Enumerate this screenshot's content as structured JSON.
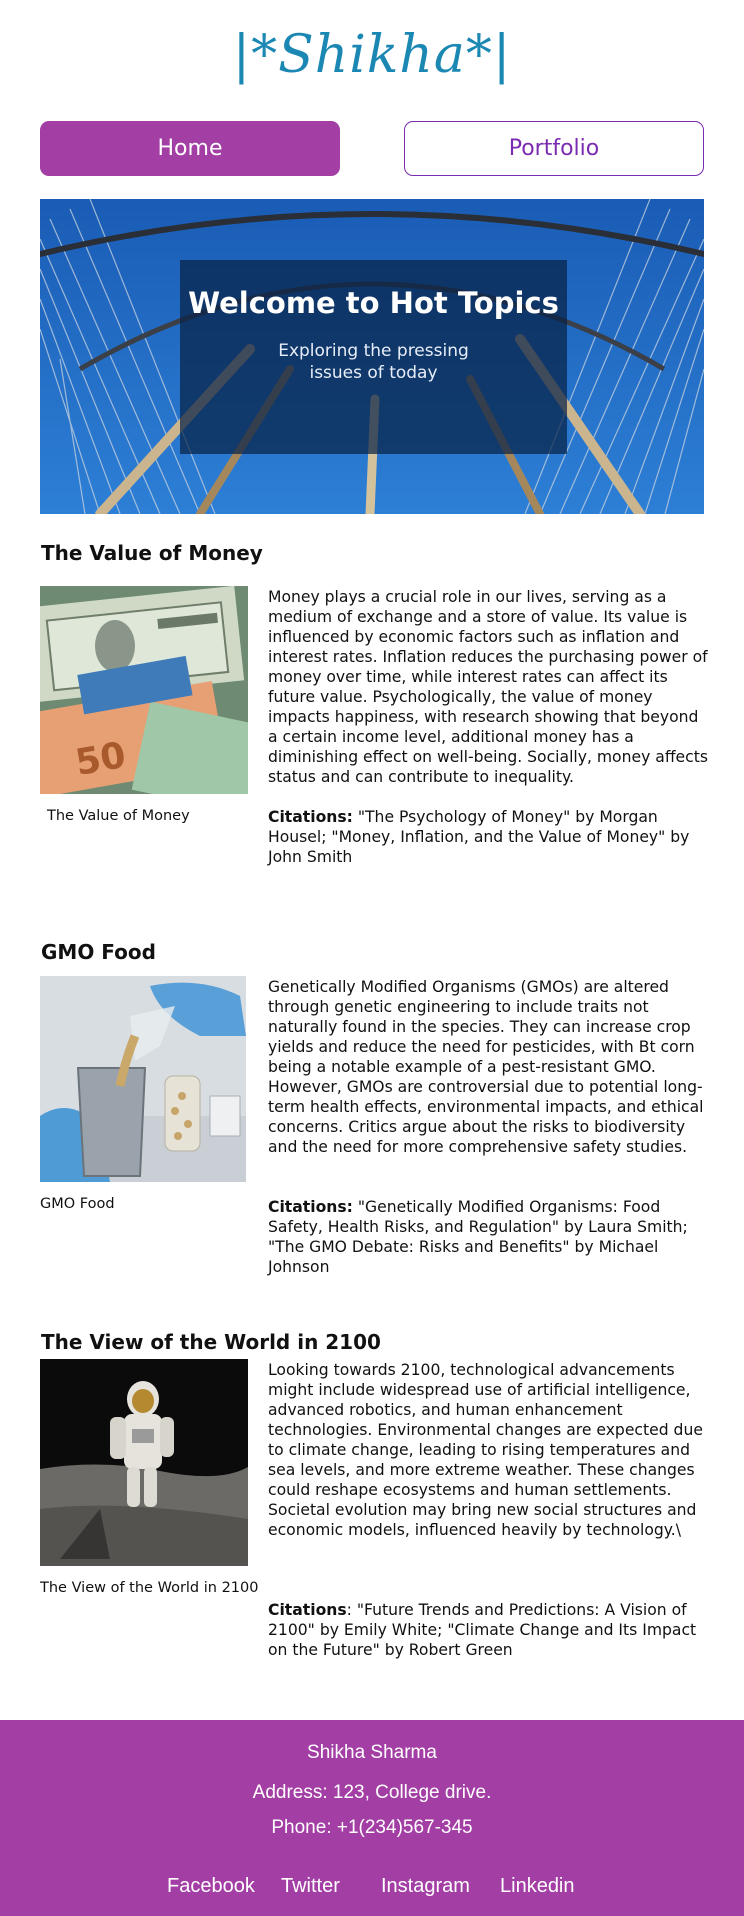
{
  "brand": {
    "logo": "|*Shikha*|"
  },
  "nav": {
    "home": "Home",
    "portfolio": "Portfolio"
  },
  "hero": {
    "title": "Welcome to Hot Topics",
    "subtitle": "Exploring the pressing issues of today"
  },
  "sections": [
    {
      "title": "The Value of Money",
      "caption": "The Value of Money",
      "body": "Money plays a crucial role in our lives, serving as a medium of exchange and a store of value. Its value is influenced by economic factors such as inflation and interest rates. Inflation reduces the purchasing power of money over time, while interest rates can affect its future value. Psychologically, the value of money impacts happiness, with research showing that beyond a certain income level, additional money has a diminishing effect on well-being. Socially, money affects status and can contribute to inequality.",
      "citations_label": "Citations:",
      "citations": " \"The Psychology of Money\" by Morgan Housel; \"Money, Inflation, and the Value of Money\" by John Smith"
    },
    {
      "title": "GMO Food",
      "caption": "GMO Food",
      "body": "Genetically Modified Organisms (GMOs) are altered through genetic engineering to include traits not naturally found in the species. They can increase crop yields and reduce the need for pesticides, with Bt corn being a notable example of a pest-resistant GMO. However, GMOs are controversial due to potential long-term health effects, environmental impacts, and ethical concerns. Critics argue about the risks to biodiversity and the need for more comprehensive safety studies.",
      "citations_label": "Citations:",
      "citations": " \"Genetically Modified Organisms: Food Safety, Health Risks, and Regulation\" by Laura Smith; \"The GMO Debate: Risks and Benefits\" by Michael Johnson"
    },
    {
      "title": "The View of the World in 2100",
      "caption": "The View of the World in 2100",
      "body": "Looking towards 2100, technological advancements might include widespread use of artificial intelligence, advanced robotics, and human enhancement technologies. Environmental changes are expected due to climate change, leading to rising temperatures and sea levels, and more extreme weather. These changes could reshape ecosystems and human settlements. Societal evolution may bring new social structures and economic models, influenced heavily by technology.\\",
      "citations_label": "Citations",
      "citations": ": \"Future Trends and Predictions: A Vision of 2100\" by Emily White; \"Climate Change and Its Impact on the Future\" by Robert Green"
    }
  ],
  "footer": {
    "name": "Shikha Sharma",
    "address": "Address: 123, College drive.",
    "phone": "Phone: +1(234)567-345",
    "social": [
      "Facebook",
      "Twitter",
      "Instagram",
      "Linkedin"
    ]
  }
}
